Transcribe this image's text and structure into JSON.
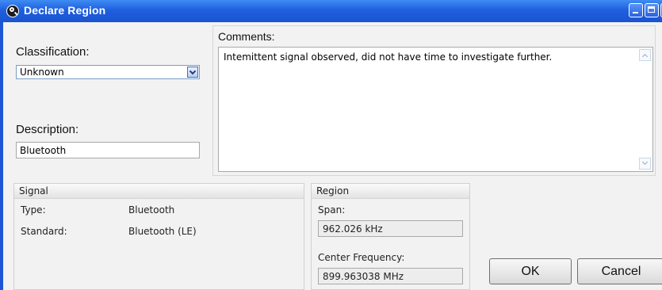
{
  "window": {
    "title": "Declare Region"
  },
  "classification": {
    "label": "Classification:",
    "value": "Unknown"
  },
  "description": {
    "label": "Description:",
    "value": "Bluetooth"
  },
  "comments": {
    "label": "Comments:",
    "value": "Intemittent signal observed, did not have time to investigate further."
  },
  "signal": {
    "header": "Signal",
    "type_label": "Type:",
    "type_value": "Bluetooth",
    "standard_label": "Standard:",
    "standard_value": "Bluetooth (LE)"
  },
  "region": {
    "header": "Region",
    "span_label": "Span:",
    "span_value": "962.026 kHz",
    "center_label": "Center Frequency:",
    "center_value": "899.963038 MHz"
  },
  "buttons": {
    "ok": "OK",
    "cancel": "Cancel"
  },
  "colors": {
    "title_bar": "#1f5fe0",
    "window_bg": "#f2f2f2"
  }
}
